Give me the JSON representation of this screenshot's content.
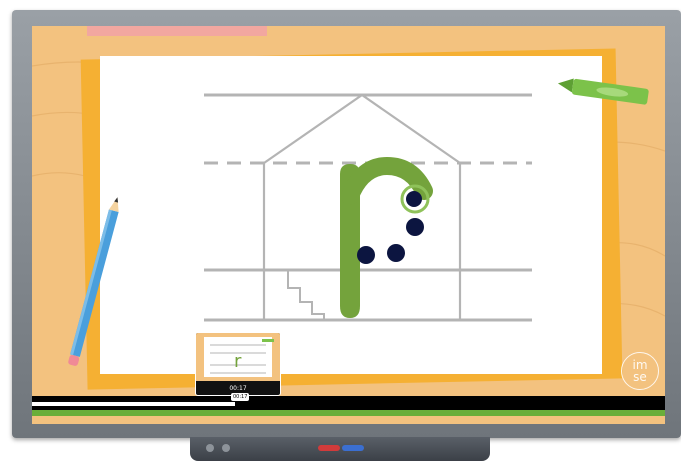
{
  "lesson": {
    "letter": "r"
  },
  "player": {
    "progress": 0.32,
    "hover_time": "00:17",
    "bubble_time": "00:17"
  },
  "brand": {
    "logo_line1": "im",
    "logo_line2": "se"
  },
  "colors": {
    "board_background": "#f3c27f",
    "paper": "#ffffff",
    "letter_green": "#74a33c",
    "dot_navy": "#0c1540",
    "guide_grey": "#b4b4b4",
    "crayon_green": "#7cc24a",
    "pencil_blue": "#4a9fdc",
    "seek_green": "#6aae3a"
  },
  "icons": {
    "crayon": "green-crayon-icon",
    "pencil": "blue-pencil-icon",
    "house": "house-outline-icon",
    "stairs": "stairs-icon"
  }
}
